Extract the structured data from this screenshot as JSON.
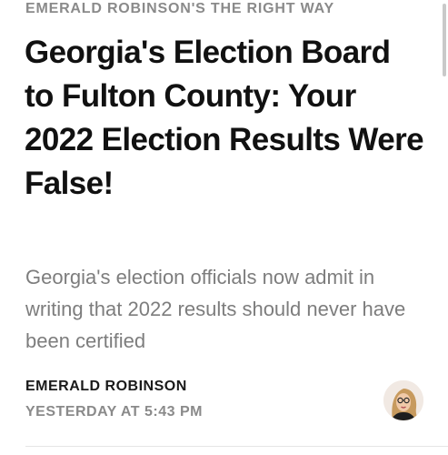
{
  "publication": {
    "name": "EMERALD ROBINSON'S THE RIGHT WAY"
  },
  "article": {
    "title": "Georgia's Election Board to Fulton County: Your 2022 Election Results Were False!",
    "subtitle": "Georgia's election officials now admit in writing that 2022 results should never have been certified"
  },
  "byline": {
    "author": "EMERALD ROBINSON",
    "timestamp": "YESTERDAY AT 5:43 PM",
    "avatar_icon": "author-avatar-photo"
  },
  "colors": {
    "title": "#111111",
    "subtitle": "#7d7d7d",
    "meta_gray": "#8a8a8a",
    "author": "#1a1a1a"
  }
}
